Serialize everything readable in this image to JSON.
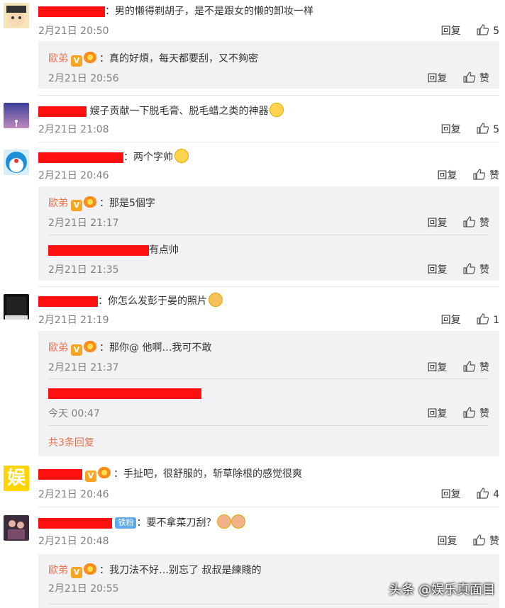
{
  "ui": {
    "reply": "回复",
    "like": "赞"
  },
  "comments": [
    {
      "text": "：男的懒得剃胡子，是不是跟女的懒的卸妆一样",
      "time": "2月21日 20:50",
      "likes": "5",
      "replies": [
        {
          "name": "歐弟",
          "text": "：真的好煩，每天都要刮，又不夠密",
          "time": "2月21日 20:56"
        }
      ]
    },
    {
      "text": "嫂子贡献一下脱毛膏、脱毛蜡之类的神器",
      "time": "2月21日 21:08",
      "likes": "5"
    },
    {
      "text": "：两个字帅",
      "time": "2月21日 20:46",
      "replies": [
        {
          "name": "歐弟",
          "text": "：那是5個字",
          "time": "2月21日 21:17"
        },
        {
          "text": "有点帅",
          "time": "2月21日 21:35"
        }
      ]
    },
    {
      "text": "：你怎么发彭于晏的照片",
      "time": "2月21日 21:19",
      "likes": "1",
      "replies": [
        {
          "name": "歐弟",
          "text": "：那你@ 他啊…我可不敢",
          "time": "2月21日 21:37"
        },
        {
          "text": "",
          "time": "今天 00:47"
        }
      ],
      "more": "共3条回复"
    },
    {
      "text": "：手扯吧，很舒服的，斩草除根的感觉很爽",
      "time": "2月21日 20:46",
      "likes": "4"
    },
    {
      "badge": "铁粉",
      "text": "：要不拿菜刀刮？",
      "time": "2月21日 20:48",
      "replies": [
        {
          "name": "歐弟",
          "text": "：我刀法不好…别忘了 叔叔是練賤的",
          "time": "2月21日 20:55"
        }
      ]
    }
  ],
  "watermark": "头条 @娱乐真面目",
  "icons": [
    "thumbs-up-icon",
    "vip-v-badge-icon",
    "crown-badge-icon",
    "grinning-emoji-icon",
    "cat-emoji-icon"
  ],
  "colors": {
    "name": "#eb7350",
    "box": "#f2f2f5",
    "redaction": "#ff1010",
    "time": "#808080"
  }
}
